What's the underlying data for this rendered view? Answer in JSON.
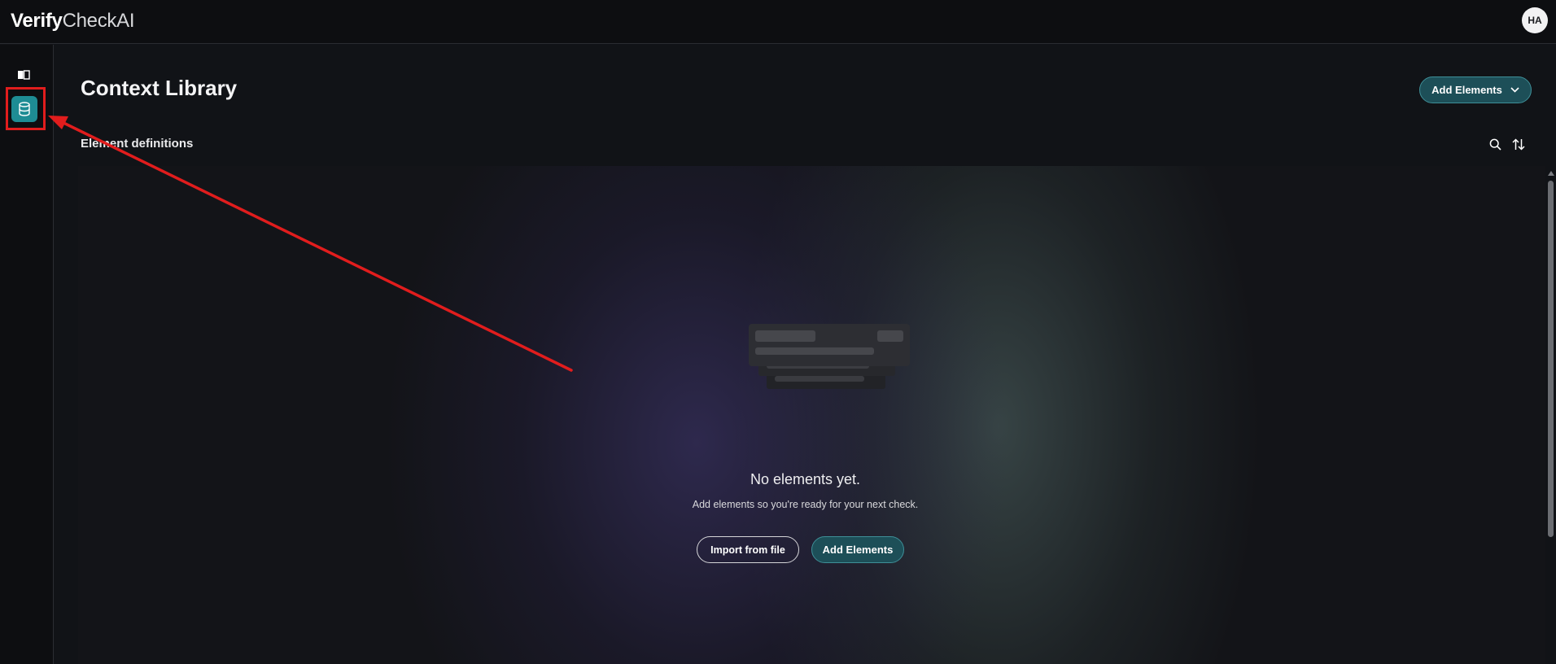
{
  "header": {
    "logo_bold": "Verify",
    "logo_light": "CheckAI",
    "avatar_initials": "HA"
  },
  "sidebar": {
    "items": [
      {
        "icon": "book-icon",
        "active": false
      },
      {
        "icon": "database-icon",
        "active": true
      }
    ]
  },
  "main": {
    "title": "Context Library",
    "add_button_label": "Add Elements",
    "section_title": "Element definitions",
    "empty_state": {
      "title": "No elements yet.",
      "subtitle": "Add elements so you're ready for your next check.",
      "import_label": "Import from file",
      "add_label": "Add Elements"
    }
  },
  "colors": {
    "accent": "#1e8c94",
    "primary_button": "#1d4f58",
    "annotation": "#e11d1d",
    "background": "#111317"
  }
}
